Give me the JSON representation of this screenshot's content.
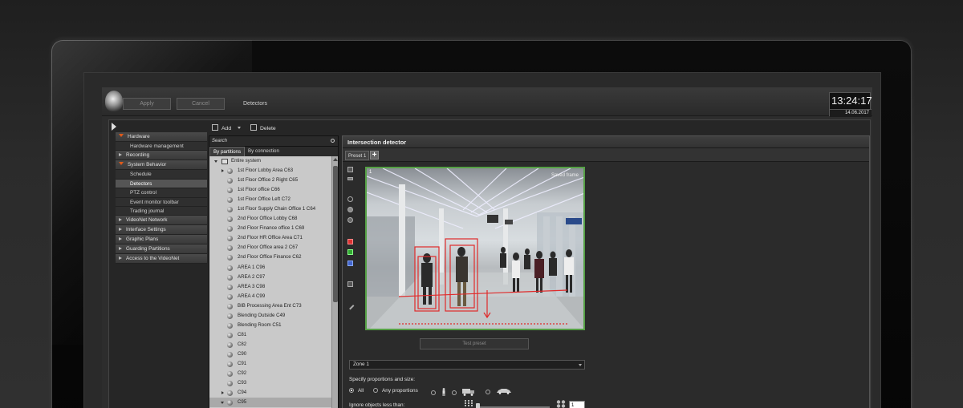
{
  "topbar": {
    "apply_label": "Apply",
    "cancel_label": "Cancel",
    "title": "Detectors",
    "time": "13:24:17",
    "date": "14.06.2017"
  },
  "toolbar": {
    "add_label": "Add",
    "delete_label": "Delete"
  },
  "nav": {
    "items": [
      {
        "label": "Hardware",
        "type": "group",
        "expanded": true
      },
      {
        "label": "Hardware management",
        "type": "sub"
      },
      {
        "label": "Recording",
        "type": "group",
        "expanded": false
      },
      {
        "label": "System Behavior",
        "type": "group",
        "expanded": true
      },
      {
        "label": "Schedule",
        "type": "sub"
      },
      {
        "label": "Detectors",
        "type": "sub",
        "active": true
      },
      {
        "label": "PTZ control",
        "type": "sub"
      },
      {
        "label": "Event monitor toolbar",
        "type": "sub"
      },
      {
        "label": "Trading journal",
        "type": "sub"
      },
      {
        "label": "VideoNet Network",
        "type": "group",
        "expanded": false
      },
      {
        "label": "Interface Settings",
        "type": "group",
        "expanded": false
      },
      {
        "label": "Graphic Plans",
        "type": "group",
        "expanded": false
      },
      {
        "label": "Guarding Partitions",
        "type": "group",
        "expanded": false
      },
      {
        "label": "Access to the VideoNet",
        "type": "group",
        "expanded": false
      }
    ]
  },
  "tree_panel": {
    "search_placeholder": "Search",
    "tab_partitions": "By partitions",
    "tab_connection": "By connection",
    "root_label": "Entire system",
    "items": [
      {
        "label": "1st Floor Lobby Area C63",
        "expandable": true
      },
      {
        "label": "1st Floor Office 2 Right C65"
      },
      {
        "label": "1st Floor office C66"
      },
      {
        "label": "1st Floor Office Left C72"
      },
      {
        "label": "1st Floor Supply Chain Office 1 C64"
      },
      {
        "label": "2nd Floor  Office Lobby C68"
      },
      {
        "label": "2nd Floor Finance office 1 C69"
      },
      {
        "label": "2nd Floor HR Office Area C71"
      },
      {
        "label": "2nd Floor Office area 2 C67"
      },
      {
        "label": "2nd Floor Office Finance  C62"
      },
      {
        "label": "AREA 1 C96"
      },
      {
        "label": "AREA 2 C97"
      },
      {
        "label": "AREA 3 C98"
      },
      {
        "label": "AREA 4 C99"
      },
      {
        "label": "BIB Processing Area Ent C73"
      },
      {
        "label": "Blending Outside  C49"
      },
      {
        "label": "Blending Room C51"
      },
      {
        "label": "C81"
      },
      {
        "label": "C82"
      },
      {
        "label": "C90"
      },
      {
        "label": "C91"
      },
      {
        "label": "C92"
      },
      {
        "label": "C93"
      },
      {
        "label": "C94",
        "expandable": true
      },
      {
        "label": "C95",
        "expandable": true,
        "expanded": true,
        "selected": true
      }
    ]
  },
  "detector": {
    "title": "Intersection detector",
    "preset_tab": "Preset 1",
    "preset_add": "+",
    "video_channel": "1",
    "video_saved": "Saved frame",
    "test_preset_label": "Test preset",
    "zone_value": "Zone 1",
    "proportions_label": "Specify proportions and size:",
    "opt_all": "All",
    "opt_any": "Any proportions",
    "ignore_label": "Ignore objects less than:",
    "ignore_value": "1"
  },
  "icons": {
    "logo": "owl-logo-icon",
    "add": "add-icon",
    "delete": "delete-icon",
    "search": "search-icon",
    "person": "person-icon",
    "truck": "truck-icon",
    "car": "car-icon"
  },
  "colors": {
    "accent_orange": "#e05a1a",
    "video_border": "#55a045",
    "detection_red": "#e02a2a"
  }
}
